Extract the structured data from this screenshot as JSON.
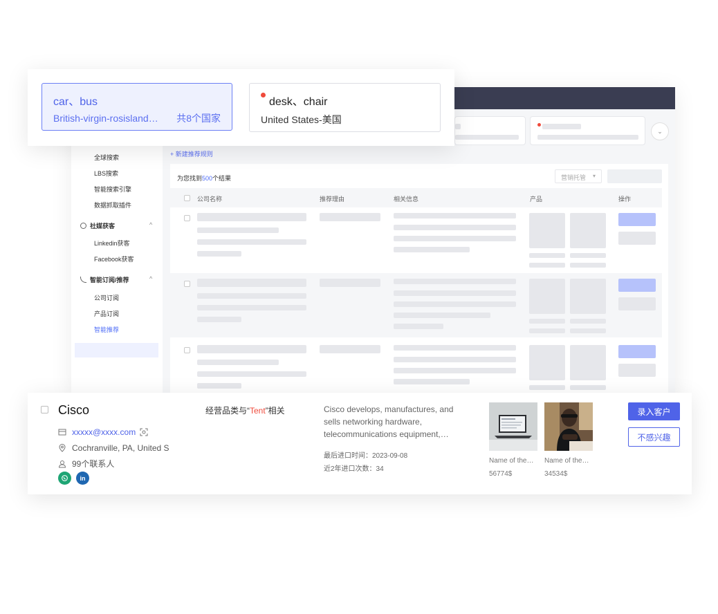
{
  "route_cards": [
    {
      "title": "car、bus",
      "subtitle": "British-virgin-rosisland…",
      "count": "共8个国家"
    },
    {
      "title": "desk、chair",
      "subtitle": "United States-美国"
    }
  ],
  "sidebar": {
    "items_top": [
      "全球搜索",
      "LBS搜索",
      "智能搜索引擎",
      "数据抓取插件"
    ],
    "group_social": "社媒获客",
    "items_social": [
      "Linkedin获客",
      "Facebook获客"
    ],
    "group_smart": "智能订阅/推荐",
    "items_smart": [
      "公司订阅",
      "产品订阅",
      "智能推荐"
    ]
  },
  "toolbar": {
    "new_rule": "+ 新建推荐规则"
  },
  "results": {
    "prefix": "为您找到",
    "count": "500",
    "suffix": "个结果",
    "dropdown": "营销托管"
  },
  "table": {
    "headers": [
      "公司名称",
      "推荐理由",
      "相关信息",
      "产品",
      "操作"
    ]
  },
  "detail": {
    "company": "Cisco",
    "email": "xxxxx@xxxx.com",
    "location": "Cochranville, PA, United S",
    "contacts": "99个联系人",
    "reason_prefix": "经营品类与“",
    "reason_keyword": "Tent",
    "reason_suffix": "”相关",
    "description": "Cisco develops, manufactures, and sells networking hardware, telecommunications equipment,…",
    "last_import": "最后进口时间：2023-09-08",
    "import_count": "近2年进口次数：34",
    "products": [
      {
        "name": "Name of the…",
        "price": "56774$"
      },
      {
        "name": "Name of the…",
        "price": "34534$"
      }
    ],
    "primary_button": "录入客户",
    "secondary_button": "不感兴趣",
    "social": [
      "whatsapp",
      "linkedin"
    ],
    "social_labels": {
      "linkedin": "in"
    }
  },
  "colors": {
    "accent": "#4f63e8",
    "header": "#3a3d52",
    "red": "#ef4a3b"
  }
}
